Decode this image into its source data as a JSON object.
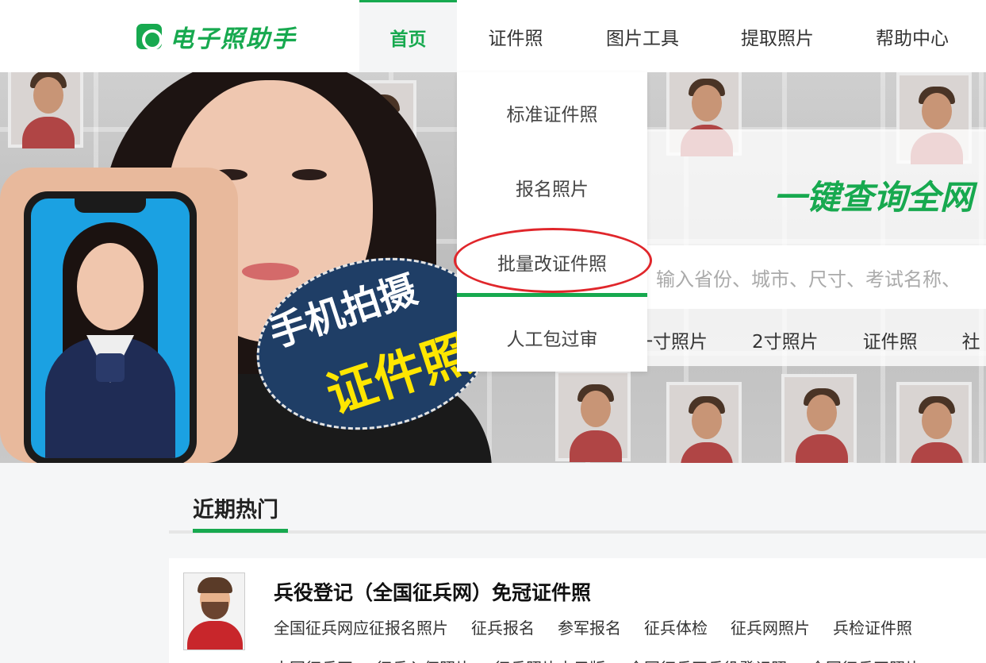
{
  "header": {
    "logo_text": "电子照助手",
    "nav": [
      {
        "label": "首页",
        "active": true
      },
      {
        "label": "证件照"
      },
      {
        "label": "图片工具"
      },
      {
        "label": "提取照片"
      },
      {
        "label": "帮助中心"
      }
    ]
  },
  "dropdown": {
    "items": [
      "标准证件照",
      "报名照片",
      "批量改证件照",
      "人工包过审"
    ],
    "highlighted_item": "批量改证件照"
  },
  "hero": {
    "bubble_line1": "手机拍摄",
    "bubble_line2": "证件照",
    "search_title": "一键查询全网",
    "search_placeholder": "输入省份、城市、尺寸、考试名称、",
    "hot_tags": [
      "一寸照片",
      "2寸照片",
      "证件照",
      "社"
    ]
  },
  "section": {
    "title": "近期热门"
  },
  "card": {
    "title": "兵役登记（全国征兵网）免冠证件照",
    "tags": [
      "全国征兵网应征报名照片",
      "征兵报名",
      "参军报名",
      "征兵体检",
      "征兵网照片",
      "兵检证件照",
      "中国征兵网",
      "征兵入伍照片",
      "征兵照片电子版",
      "全国征兵网兵役登记照",
      "全国征兵网照片"
    ]
  },
  "colors": {
    "brand_green": "#17a94f",
    "highlight_red": "#e0262b",
    "bubble_navy": "#1f3e66",
    "bubble_yellow": "#ffe600"
  }
}
